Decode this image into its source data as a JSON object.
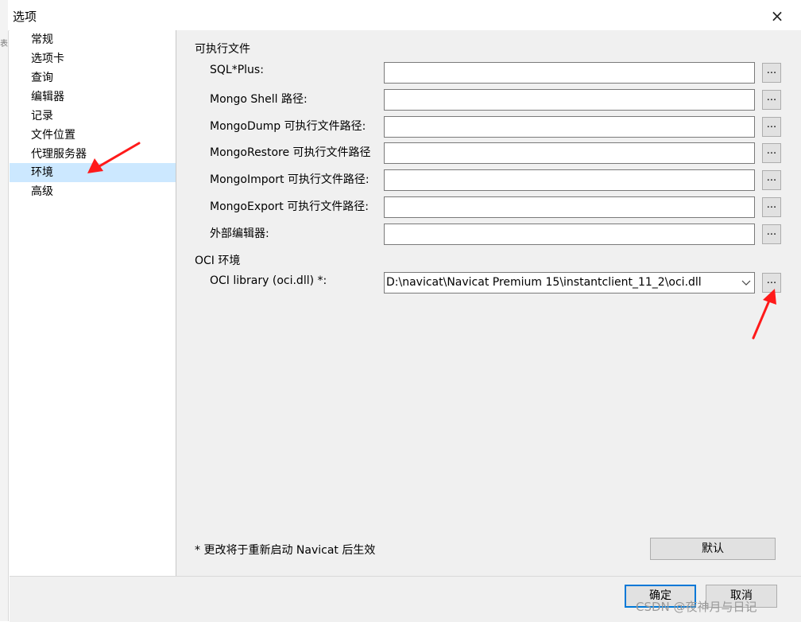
{
  "window": {
    "title": "选项",
    "close_label": "×"
  },
  "sidebar": {
    "items": [
      {
        "label": "常规",
        "selected": false
      },
      {
        "label": "选项卡",
        "selected": false
      },
      {
        "label": "查询",
        "selected": false
      },
      {
        "label": "编辑器",
        "selected": false
      },
      {
        "label": "记录",
        "selected": false
      },
      {
        "label": "文件位置",
        "selected": false
      },
      {
        "label": "代理服务器",
        "selected": false
      },
      {
        "label": "环境",
        "selected": true
      },
      {
        "label": "高级",
        "selected": false
      }
    ]
  },
  "main": {
    "exec_group_label": "可执行文件",
    "fields": [
      {
        "label": "SQL*Plus:",
        "value": ""
      },
      {
        "label": "Mongo Shell 路径:",
        "value": ""
      },
      {
        "label": "MongoDump 可执行文件路径:",
        "value": ""
      },
      {
        "label": "MongoRestore 可执行文件路径",
        "value": ""
      },
      {
        "label": "MongoImport 可执行文件路径:",
        "value": ""
      },
      {
        "label": "MongoExport 可执行文件路径:",
        "value": ""
      },
      {
        "label": "外部编辑器:",
        "value": ""
      }
    ],
    "browse_label": "...",
    "oci_group_label": "OCI 环境",
    "oci_label": "OCI library (oci.dll) *:",
    "oci_value": "D:\\navicat\\Navicat Premium 15\\instantclient_11_2\\oci.dll",
    "note": "* 更改将于重新启动 Navicat 后生效",
    "default_button": "默认"
  },
  "footer": {
    "ok_label": "确定",
    "cancel_label": "取消"
  },
  "watermark": "CSDN @夜神月与日记",
  "colors": {
    "selection": "#cce8ff",
    "annotation_arrow": "#ff1a1a",
    "focus_border": "#0078d7"
  }
}
